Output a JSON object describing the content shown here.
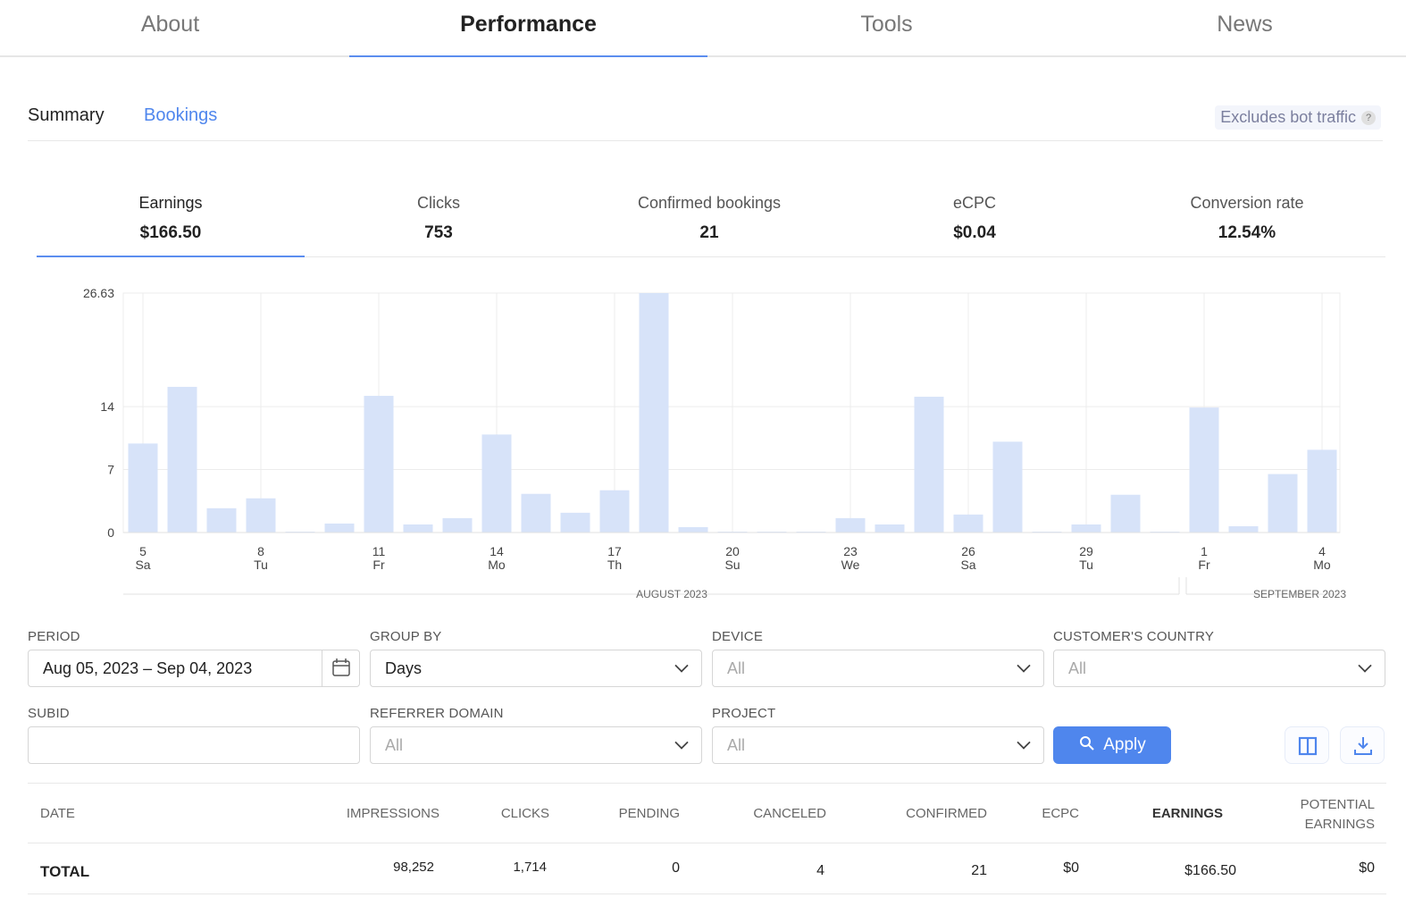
{
  "top_tabs": [
    {
      "label": "About"
    },
    {
      "label": "Performance",
      "active": true
    },
    {
      "label": "Tools"
    },
    {
      "label": "News"
    }
  ],
  "sub_tabs": [
    {
      "label": "Summary"
    },
    {
      "label": "Bookings"
    }
  ],
  "bot_badge": {
    "label": "Excludes bot traffic",
    "help": "?"
  },
  "metrics": [
    {
      "label": "Earnings",
      "value": "$166.50",
      "active": true
    },
    {
      "label": "Clicks",
      "value": "753"
    },
    {
      "label": "Confirmed bookings",
      "value": "21"
    },
    {
      "label": "eCPC",
      "value": "$0.04"
    },
    {
      "label": "Conversion rate",
      "value": "12.54%"
    }
  ],
  "chart_data": {
    "type": "bar",
    "color": "#d7e3f9",
    "ylim": [
      0,
      26.63
    ],
    "y_ticks": [
      "0",
      "7",
      "14",
      "26.63"
    ],
    "grid": true,
    "x_ticks": [
      {
        "day": "5",
        "dow": "Sa"
      },
      {
        "day": "8",
        "dow": "Tu"
      },
      {
        "day": "11",
        "dow": "Fr"
      },
      {
        "day": "14",
        "dow": "Mo"
      },
      {
        "day": "17",
        "dow": "Th"
      },
      {
        "day": "20",
        "dow": "Su"
      },
      {
        "day": "23",
        "dow": "We"
      },
      {
        "day": "26",
        "dow": "Sa"
      },
      {
        "day": "29",
        "dow": "Tu"
      },
      {
        "day": "1",
        "dow": "Fr"
      },
      {
        "day": "4",
        "dow": "Mo"
      }
    ],
    "months": [
      "AUGUST 2023",
      "SEPTEMBER 2023"
    ],
    "categories": [
      "2023-08-05",
      "2023-08-06",
      "2023-08-07",
      "2023-08-08",
      "2023-08-09",
      "2023-08-10",
      "2023-08-11",
      "2023-08-12",
      "2023-08-13",
      "2023-08-14",
      "2023-08-15",
      "2023-08-16",
      "2023-08-17",
      "2023-08-18",
      "2023-08-19",
      "2023-08-20",
      "2023-08-21",
      "2023-08-22",
      "2023-08-23",
      "2023-08-24",
      "2023-08-25",
      "2023-08-26",
      "2023-08-27",
      "2023-08-28",
      "2023-08-29",
      "2023-08-30",
      "2023-08-31",
      "2023-09-01",
      "2023-09-02",
      "2023-09-03",
      "2023-09-04"
    ],
    "values": [
      9.9,
      16.2,
      2.7,
      3.8,
      0.1,
      1.0,
      15.2,
      0.9,
      1.6,
      10.9,
      4.3,
      2.2,
      4.7,
      26.63,
      0.6,
      0.1,
      0.1,
      0.1,
      1.6,
      0.9,
      15.1,
      2.0,
      10.1,
      0.1,
      0.9,
      4.2,
      0.1,
      13.9,
      0.7,
      6.5,
      9.2
    ]
  },
  "filters": {
    "period": {
      "label": "PERIOD",
      "value": "Aug 05, 2023 – Sep 04, 2023"
    },
    "group_by": {
      "label": "GROUP BY",
      "value": "Days"
    },
    "device": {
      "label": "DEVICE",
      "value": "All"
    },
    "country": {
      "label": "CUSTOMER'S COUNTRY",
      "value": "All"
    },
    "subid": {
      "label": "SUBID",
      "value": ""
    },
    "referrer": {
      "label": "REFERRER DOMAIN",
      "value": "All"
    },
    "project": {
      "label": "PROJECT",
      "value": "All"
    },
    "apply": "Apply"
  },
  "table": {
    "headers": [
      "DATE",
      "IMPRESSIONS",
      "CLICKS",
      "PENDING",
      "CANCELED",
      "CONFIRMED",
      "ECPC",
      "EARNINGS",
      "POTENTIAL",
      "EARNINGS"
    ],
    "total": [
      "TOTAL",
      "98,252",
      "1,714",
      "0",
      "4",
      "21",
      "$0",
      "$166.50",
      "$0"
    ]
  }
}
